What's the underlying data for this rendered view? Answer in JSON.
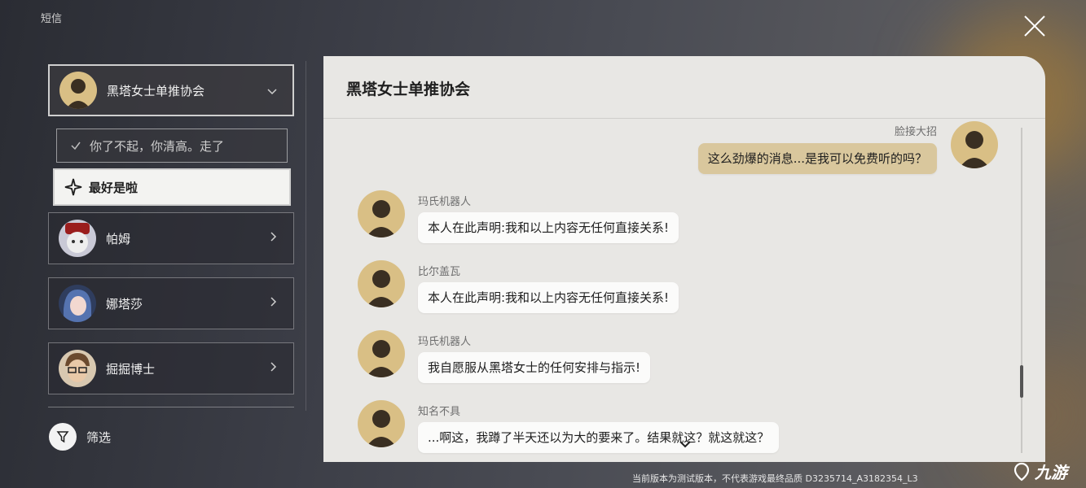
{
  "header": {
    "title": "短信"
  },
  "contacts": [
    {
      "name": "黑塔女士单推协会",
      "avatar": "silhouette-avatar",
      "expanded": true
    },
    {
      "name": "帕姆",
      "avatar": "pom-pom-avatar"
    },
    {
      "name": "娜塔莎",
      "avatar": "natasha-avatar"
    },
    {
      "name": "掘掘博士",
      "avatar": "doctor-avatar"
    }
  ],
  "choices": {
    "done": "你了不起，你清高。走了",
    "current": "最好是啦"
  },
  "filter": {
    "label": "筛选"
  },
  "chat": {
    "title": "黑塔女士单推协会",
    "messages": [
      {
        "sender": "脸接大招",
        "text": "这么劲爆的消息...是我可以免费听的吗？",
        "mine": true
      },
      {
        "sender": "玛氏机器人",
        "text": "本人在此声明:我和以上内容无任何直接关系!"
      },
      {
        "sender": "比尔盖瓦",
        "text": "本人在此声明:我和以上内容无任何直接关系!"
      },
      {
        "sender": "玛氏机器人",
        "text": "我自愿服从黑塔女士的任何安排与指示!"
      },
      {
        "sender": "知名不具",
        "text": "...啊这，我蹲了半天还以为大的要来了。结果就这？就这就这？"
      }
    ]
  },
  "footer": {
    "notice": "当前版本为测试版本，不代表游戏最终品质  D3235714_A3182354_L3"
  },
  "watermark": {
    "text": "九游"
  },
  "colors": {
    "mine_bubble": "#d9c79d",
    "avatar_gold": "#d9bf85",
    "panel": "#e8e7e4"
  }
}
